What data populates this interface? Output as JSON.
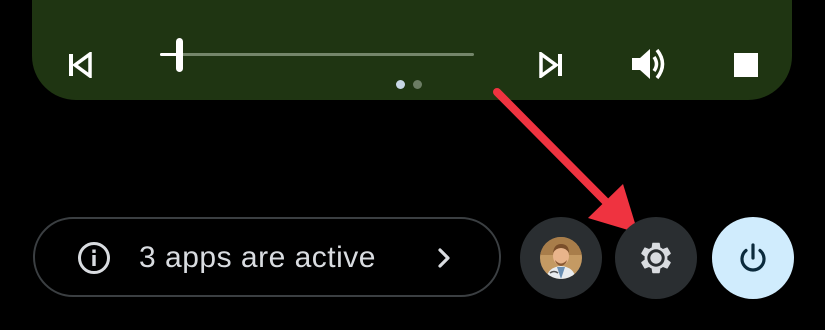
{
  "media": {
    "controls": {
      "previous_icon": "skip-previous-icon",
      "next_icon": "skip-next-icon",
      "volume_icon": "volume-up-icon",
      "stop_icon": "stop-icon"
    },
    "progress": 0.06,
    "pages": {
      "count": 2,
      "active": 0
    }
  },
  "status": {
    "info_icon": "info-icon",
    "apps_active_label": "3 apps are active",
    "chevron_icon": "chevron-right-icon"
  },
  "quick_buttons": {
    "avatar_icon": "user-avatar",
    "settings_icon": "gear-icon",
    "power_icon": "power-icon"
  },
  "colors": {
    "media_card": "#1f3512",
    "seek_track": "#74866a",
    "round_button": "#2a2e31",
    "power_button": "#d0ecfd",
    "annotation_arrow": "#ef3340"
  }
}
